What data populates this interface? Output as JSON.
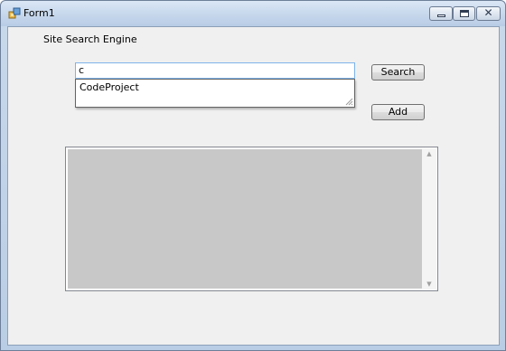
{
  "window": {
    "title": "Form1",
    "close_glyph": "✕"
  },
  "form": {
    "heading": "Site Search Engine",
    "search_value": "c",
    "suggestions": [
      "CodeProject"
    ],
    "search_button_label": "Search",
    "add_button_label": "Add"
  },
  "list": {
    "items": [],
    "scroll_up_glyph": "▲",
    "scroll_down_glyph": "▼"
  },
  "colors": {
    "titlebar": "#c6d7ec",
    "client_background": "#f0f0f0",
    "list_fill": "#c8c8c8",
    "input_focus_border": "#7eb4ea"
  }
}
